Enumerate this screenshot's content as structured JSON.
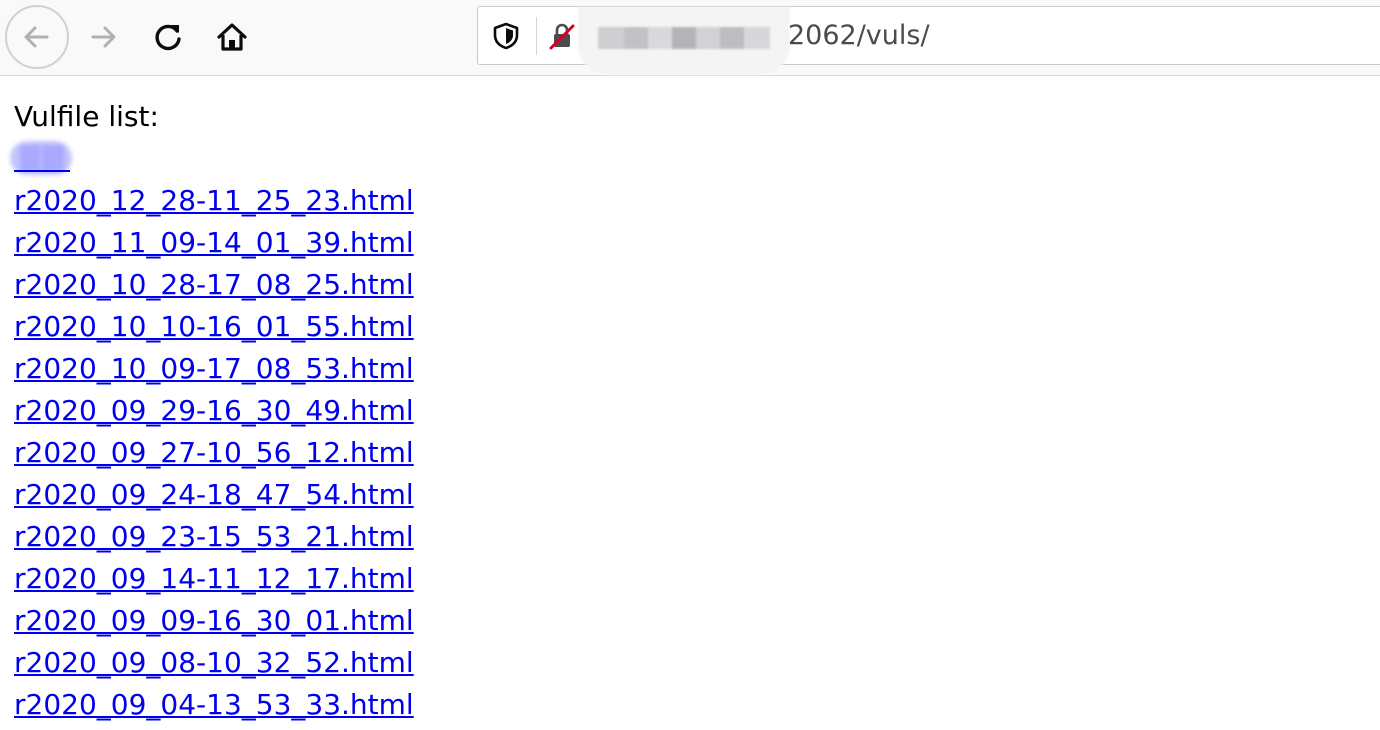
{
  "browser": {
    "toolbar": {
      "back_icon": "arrow-left-icon",
      "forward_icon": "arrow-right-icon",
      "reload_icon": "reload-icon",
      "home_icon": "home-icon"
    },
    "urlbar": {
      "visible_url_text": "2062/vuls/",
      "tracking_protection_icon": "shield-icon",
      "connection_icon": "insecure-lock-icon"
    }
  },
  "page": {
    "heading": "Vulfile list:",
    "files": [
      "r2020_12_28-11_25_23.html",
      "r2020_11_09-14_01_39.html",
      "r2020_10_28-17_08_25.html",
      "r2020_10_10-16_01_55.html",
      "r2020_10_09-17_08_53.html",
      "r2020_09_29-16_30_49.html",
      "r2020_09_27-10_56_12.html",
      "r2020_09_24-18_47_54.html",
      "r2020_09_23-15_53_21.html",
      "r2020_09_14-11_12_17.html",
      "r2020_09_09-16_30_01.html",
      "r2020_09_08-10_32_52.html",
      "r2020_09_04-13_53_33.html"
    ]
  },
  "colors": {
    "link": "#0000ee",
    "toolbar_bg": "#f9f9fa",
    "text": "#000000"
  }
}
